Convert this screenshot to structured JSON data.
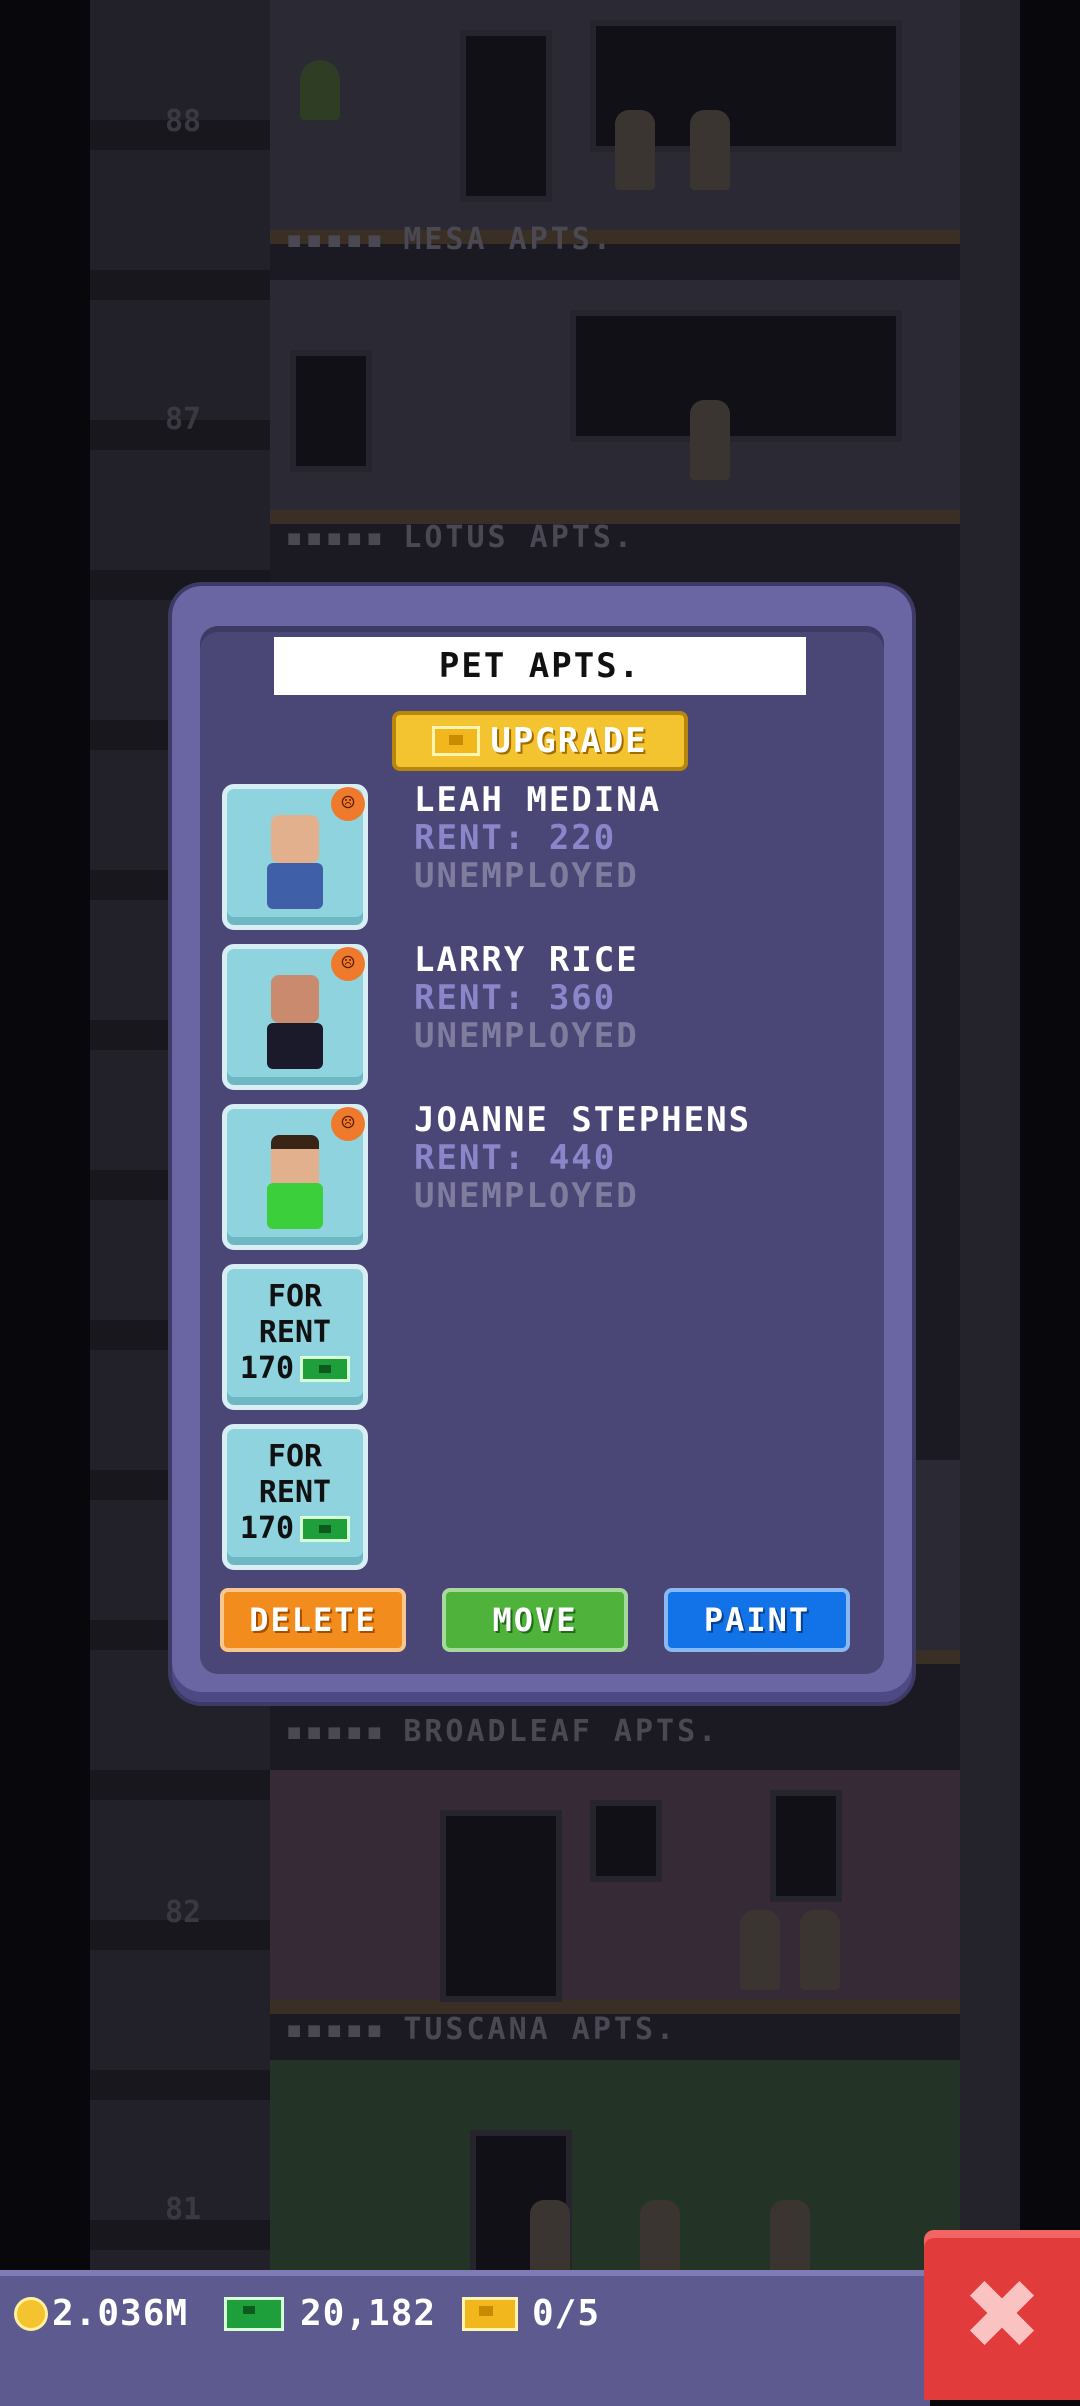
{
  "background": {
    "floors": [
      {
        "number": "88",
        "label": "MESA APTS."
      },
      {
        "number": "87",
        "label": "LOTUS APTS."
      },
      {
        "number": "",
        "label": "BROADLEAF APTS."
      },
      {
        "number": "82",
        "label": "TUSCANA APTS."
      },
      {
        "number": "81",
        "label": ""
      }
    ]
  },
  "dialog": {
    "title": "PET APTS.",
    "upgrade_label": "UPGRADE",
    "tenants": [
      {
        "name": "LEAH MEDINA",
        "rent": "RENT: 220",
        "job": "UNEMPLOYED",
        "mood": "sad",
        "shirt": "#3f5fa8"
      },
      {
        "name": "LARRY RICE",
        "rent": "RENT: 360",
        "job": "UNEMPLOYED",
        "mood": "sad",
        "shirt": "#1a1a2a"
      },
      {
        "name": "JOANNE STEPHENS",
        "rent": "RENT: 440",
        "job": "UNEMPLOYED",
        "mood": "sad",
        "shirt": "#3ccf3c"
      }
    ],
    "vacancies": [
      {
        "line1": "FOR",
        "line2": "RENT",
        "price": "170"
      },
      {
        "line1": "FOR",
        "line2": "RENT",
        "price": "170"
      }
    ],
    "buttons": {
      "delete": "DELETE",
      "move": "MOVE",
      "paint": "PAINT"
    },
    "sad_face": "☹"
  },
  "status_bar": {
    "coins": "2.036M",
    "bux_cash": "20,182",
    "bux_gold": "0/5"
  },
  "close_symbol": "✖",
  "colors": {
    "delete": "#f28c1c",
    "move": "#4fb33b",
    "paint": "#1273e8",
    "close": "#e23b3b"
  }
}
